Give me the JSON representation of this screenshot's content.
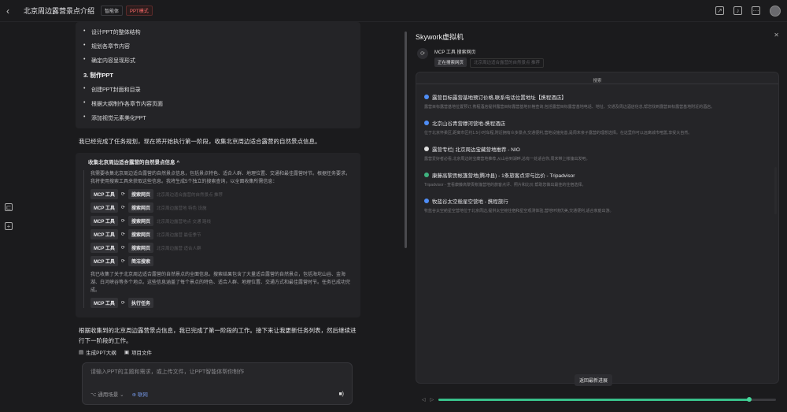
{
  "topbar": {
    "title": "北京周边露营景点介绍",
    "badge_mode": "智能体",
    "badge_ppt": "PPT模式"
  },
  "plan": {
    "items_a": [
      "设计PPT的整体结构",
      "规划各章节内容",
      "确定内容呈现形式"
    ],
    "section3": "3. 制作PPT",
    "items_b": [
      "创建PPT封面和目录",
      "根据大纲制作各章节内容页面",
      "添加视觉元素美化PPT"
    ]
  },
  "message1": "我已经完成了任务规划，现在将开始执行第一阶段，收集北京周边适合露营的自然景点信息。",
  "collapse": {
    "title": "收集北京周边适合露营的自然景点信息",
    "intro": "我需要收集北京周边适合露营的自然景点信息，包括景点特色、适合人群、地理位置、交通和最佳露营时节。根据任务要求，我将使用搜索工具来获取这些信息。我将生成5个独立的搜索查询，以全面收集所需信息：",
    "tools": [
      {
        "tag": "MCP 工具",
        "action": "搜索网页",
        "arg": "北京周边适合露营的自然景点 推荐"
      },
      {
        "tag": "MCP 工具",
        "action": "搜索网页",
        "arg": "北京周边露营地 特色 设施"
      },
      {
        "tag": "MCP 工具",
        "action": "搜索网页",
        "arg": "北京周边露营地点 交通 路线"
      },
      {
        "tag": "MCP 工具",
        "action": "搜索网页",
        "arg": "北京周边露营 最佳季节"
      },
      {
        "tag": "MCP 工具",
        "action": "搜索网页",
        "arg": "北京周边露营 适合人群"
      }
    ],
    "tool6": {
      "tag": "MCP 工具",
      "action": "简洁搜索"
    },
    "summary": "我已收集了关于北京周边适合露营的自然景点的全面信息。搜索结果包含了大量适合露营的自然景点，包括海坨山谷、金海湖、白河峡谷等多个地点。这些信息涵盖了每个景点的特色、适合人群、地理位置、交通方式和最佳露营时节。任务已成功完成。",
    "tool7": {
      "tag": "MCP 工具",
      "action": "执行任务"
    }
  },
  "message2": "根据收集到的北京周边露营景点信息，我已完成了第一阶段的工作。接下来让我更新任务列表，然后继续进行下一阶段的工作。",
  "actions": {
    "gen_ppt": "生成PPT大纲",
    "project_files": "项目文件"
  },
  "input": {
    "placeholder": "请输入PPT的主题和需求，或上传文件，让PPT智能体帮你制作",
    "scene": "通用场景",
    "web": "联网"
  },
  "vm": {
    "title": "Skywork虚拟机",
    "tool_label": "MCP 工具 搜索网页",
    "status": "正在搜索网页",
    "query": "北京周边适合露营的自然景点 推荐",
    "screen_header": "搜索",
    "results": [
      {
        "title": "露营目标露营基地预订价格,联系电话位置地址【携程酒店】",
        "desc": "露营目标露营基地位置预订,携程酒店提供露营目标露营基地价格查询,包括露营目标露营基地电话、地址、交通及周边酒店信息,帮您找到露营目标露营基地附近的酒店。",
        "color": "#4f8ef7"
      },
      {
        "title": "北京山谷青营穆河营地-携程酒店",
        "desc": "位于北京怀柔区,距离市区约1.5小时车程,附近拥有众多景点,交通便利,营地设施完善,是周末亲子露营的理想选择。在这里你可以远离城市喧嚣,享受大自然。",
        "color": "#4f8ef7"
      },
      {
        "title": "露营专栏| 北京周边宝藏营地推荐 - NIO",
        "desc": "露营爱好者必看,北京周边的宝藏营地推荐,从山谷到湖畔,总有一处适合你,周末带上帐篷出发吧。",
        "color": "#e0e0e0"
      },
      {
        "title": "康藤高黎贡帐篷营地(腾冲县) - 1条旅客点评与比价 - Tripadvisor",
        "desc": "Tripadvisor - 查看康藤高黎贡帐篷营地的旅客点评、照片和比价,帮助您做出最佳的住宿选择。",
        "color": "#3fb27f"
      },
      {
        "title": "牧蓝谷太空舱星空营地 - 携程旅行",
        "desc": "牧蓝谷太空舱星空营地位于北京周边,提供太空舱住宿和星空观测体验,营地环境优美,交通便利,适合家庭出游。",
        "color": "#4f8ef7"
      }
    ],
    "return_label": "返回最新进展",
    "progress": 0.92
  }
}
